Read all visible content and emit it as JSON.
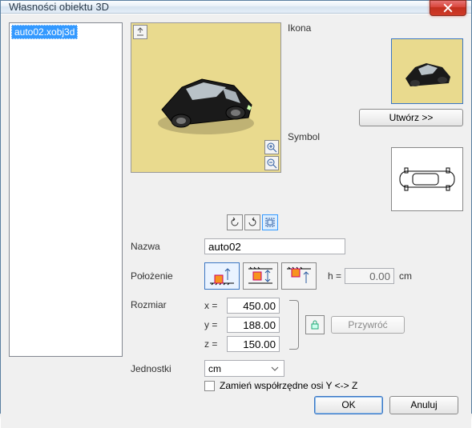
{
  "window": {
    "title": "Własności obiektu 3D"
  },
  "list": {
    "items": [
      "auto02.xobj3d"
    ],
    "selected": 0
  },
  "side": {
    "icon_label": "Ikona",
    "create_label": "Utwórz >>",
    "symbol_label": "Symbol"
  },
  "form": {
    "name_label": "Nazwa",
    "name_value": "auto02",
    "position_label": "Położenie",
    "h_label": "h =",
    "h_value": "0.00",
    "h_unit": "cm",
    "size_label": "Rozmiar",
    "x_label": "x =",
    "y_label": "y =",
    "z_label": "z =",
    "x_value": "450.00",
    "y_value": "188.00",
    "z_value": "150.00",
    "restore_label": "Przywróć",
    "units_label": "Jednostki",
    "units_value": "cm",
    "swap_label": "Zamień współrzędne osi Y <-> Z"
  },
  "footer": {
    "ok": "OK",
    "cancel": "Anuluj"
  }
}
